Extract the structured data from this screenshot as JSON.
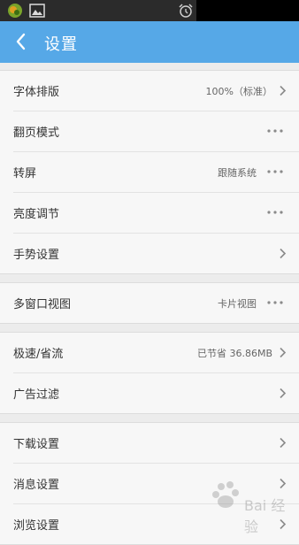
{
  "status_icons": [
    "app-icon",
    "image-icon",
    "alarm-icon"
  ],
  "header": {
    "title": "设置"
  },
  "groups": [
    {
      "rows": [
        {
          "label": "字体排版",
          "value": "100%（标准）",
          "control": "chevron"
        },
        {
          "label": "翻页模式",
          "value": "",
          "control": "more"
        },
        {
          "label": "转屏",
          "value": "跟随系统",
          "control": "more"
        },
        {
          "label": "亮度调节",
          "value": "",
          "control": "more"
        },
        {
          "label": "手势设置",
          "value": "",
          "control": "chevron"
        }
      ]
    },
    {
      "rows": [
        {
          "label": "多窗口视图",
          "value": "卡片视图",
          "control": "more"
        }
      ]
    },
    {
      "rows": [
        {
          "label": "极速/省流",
          "value": "已节省 36.86MB",
          "control": "chevron"
        },
        {
          "label": "广告过滤",
          "value": "",
          "control": "chevron"
        }
      ]
    },
    {
      "rows": [
        {
          "label": "下载设置",
          "value": "",
          "control": "chevron"
        },
        {
          "label": "消息设置",
          "value": "",
          "control": "chevron"
        },
        {
          "label": "浏览设置",
          "value": "",
          "control": "chevron"
        }
      ]
    }
  ],
  "watermark": {
    "text": "Bai 经验",
    "icon": "baidu-paw-icon"
  },
  "colors": {
    "titlebar": "#56a8e7",
    "background": "#ececec",
    "row_bg": "#f7f7f7"
  }
}
